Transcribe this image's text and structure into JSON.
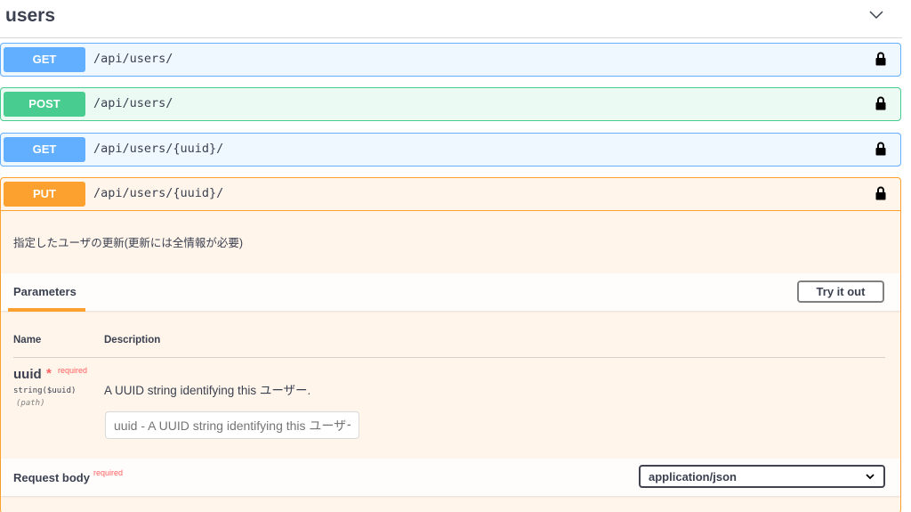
{
  "tag": {
    "title": "users"
  },
  "operations": [
    {
      "method": "GET",
      "path": "/api/users/"
    },
    {
      "method": "POST",
      "path": "/api/users/"
    },
    {
      "method": "GET",
      "path": "/api/users/{uuid}/"
    },
    {
      "method": "PUT",
      "path": "/api/users/{uuid}/"
    }
  ],
  "expanded": {
    "description": "指定したユーザの更新(更新には全情報が必要)",
    "parameters_title": "Parameters",
    "try_it_out": "Try it out",
    "columns": {
      "name": "Name",
      "description": "Description"
    },
    "param": {
      "name": "uuid",
      "star": "*",
      "required": "required",
      "type": "string($uuid)",
      "in": "(path)",
      "description": "A UUID string identifying this ユーザー.",
      "placeholder": "uuid - A UUID string identifying this ユーザー."
    },
    "request_body": {
      "title": "Request body",
      "required": "required",
      "content_type": "application/json"
    }
  },
  "colors": {
    "get": "#61affe",
    "post": "#49cc90",
    "put": "#fca130",
    "required": "#ff6060"
  },
  "icons": {
    "lock": "lock-icon",
    "chevron": "chevron-down-icon"
  }
}
